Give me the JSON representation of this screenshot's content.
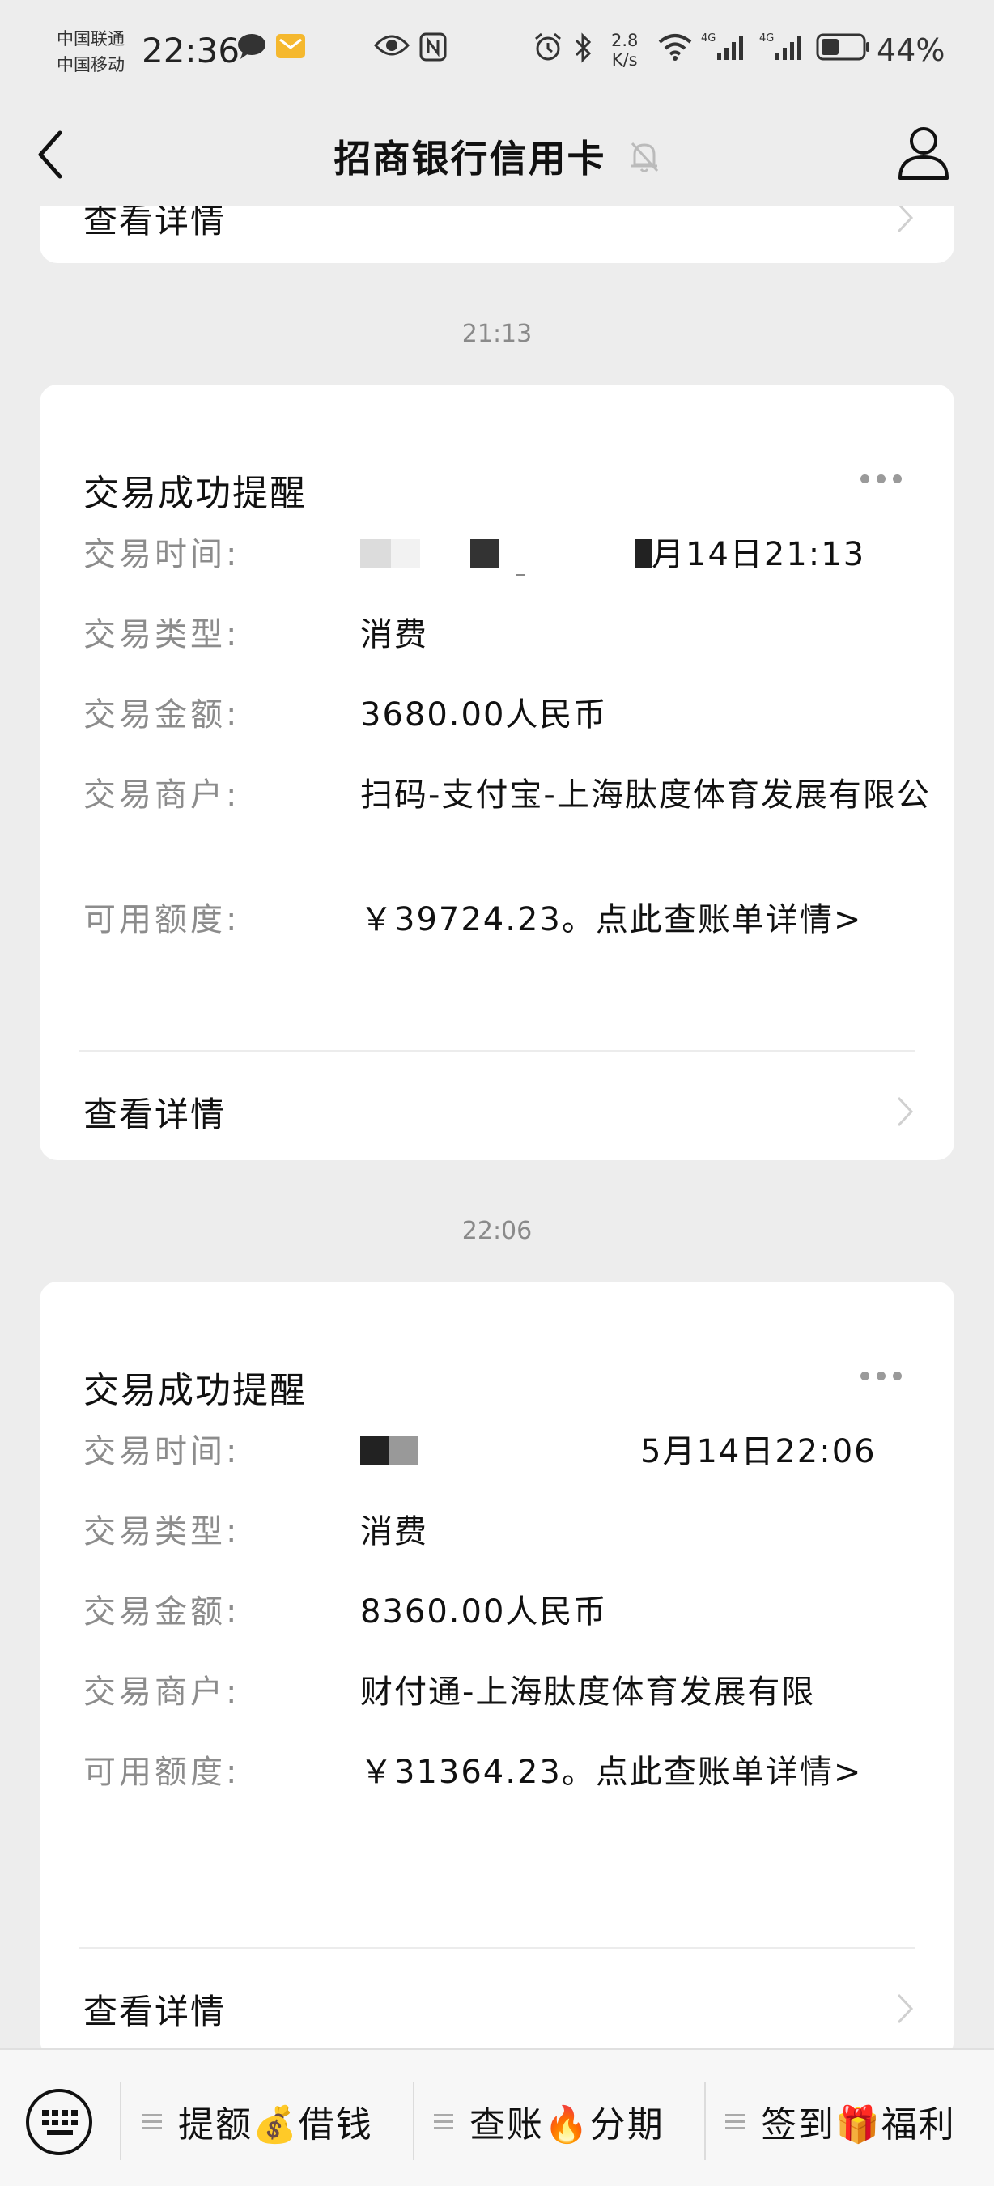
{
  "status_bar": {
    "carrier_1": "中国联通",
    "carrier_2": "中国移动",
    "time": "22:36",
    "net_speed_value": "2.8",
    "net_speed_unit": "K/s",
    "network_1": "4G",
    "network_2": "4G",
    "battery": "44%",
    "battery_level": 0.44
  },
  "nav": {
    "title": "招商银行信用卡"
  },
  "top_partial": {
    "detail_label": "查看详情"
  },
  "messages": [
    {
      "time": "21:13",
      "title": "交易成功提醒",
      "fields": [
        {
          "label": "交易时间:",
          "value": "月14日21:13"
        },
        {
          "label": "交易类型:",
          "value": "消费"
        },
        {
          "label": "交易金额:",
          "value": "3680.00人民币"
        },
        {
          "label": "交易商户:",
          "value": "扫码-支付宝-上海肽度体育发展有限公"
        },
        {
          "label": "可用额度:",
          "value": "￥39724.23。点此查账单详情>"
        }
      ],
      "detail_label": "查看详情"
    },
    {
      "time": "22:06",
      "title": "交易成功提醒",
      "fields": [
        {
          "label": "交易时间:",
          "value": "5月14日22:06"
        },
        {
          "label": "交易类型:",
          "value": "消费"
        },
        {
          "label": "交易金额:",
          "value": "8360.00人民币"
        },
        {
          "label": "交易商户:",
          "value": "财付通-上海肽度体育发展有限"
        },
        {
          "label": "可用额度:",
          "value": "￥31364.23。点此查账单详情>"
        }
      ],
      "detail_label": "查看详情"
    }
  ],
  "bottom_menu": [
    {
      "label": "提额💰借钱"
    },
    {
      "label": "查账🔥分期"
    },
    {
      "label": "签到🎁福利"
    }
  ],
  "colors": {
    "background": "#ededed",
    "card": "#ffffff",
    "label_gray": "#8c8c8c",
    "text": "#111111"
  },
  "icons": [
    "back-arrow-icon",
    "mute-bell-icon",
    "profile-icon",
    "more-dots-icon",
    "chevron-right-icon",
    "keyboard-icon",
    "menu-lines-icon"
  ]
}
